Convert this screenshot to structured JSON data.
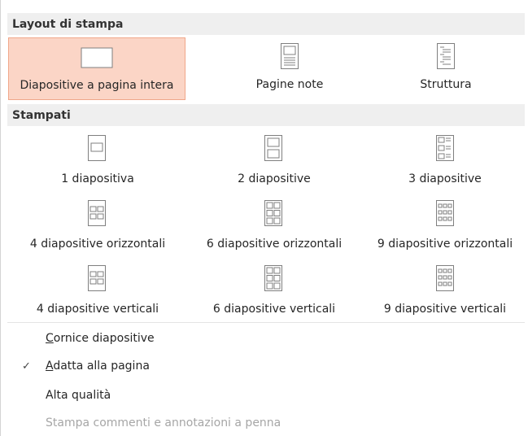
{
  "sections": {
    "layout_title": "Layout di stampa",
    "handouts_title": "Stampati"
  },
  "layout_tiles": [
    {
      "label": "Diapositive a pagina intera",
      "icon": "full-page-slide-icon",
      "selected": true
    },
    {
      "label": "Pagine note",
      "icon": "notes-page-icon",
      "selected": false
    },
    {
      "label": "Struttura",
      "icon": "outline-icon",
      "selected": false
    }
  ],
  "handouts": [
    {
      "label": "1 diapositiva",
      "icon": "one-slide-icon"
    },
    {
      "label": "2 diapositive",
      "icon": "two-slides-icon"
    },
    {
      "label": "3 diapositive",
      "icon": "three-slides-icon"
    },
    {
      "label": "4 diapositive orizzontali",
      "icon": "four-slides-horizontal-icon"
    },
    {
      "label": "6 diapositive orizzontali",
      "icon": "six-slides-horizontal-icon"
    },
    {
      "label": "9 diapositive orizzontali",
      "icon": "nine-slides-horizontal-icon"
    },
    {
      "label": "4 diapositive verticali",
      "icon": "four-slides-vertical-icon"
    },
    {
      "label": "6 diapositive verticali",
      "icon": "six-slides-vertical-icon"
    },
    {
      "label": "9 diapositive verticali",
      "icon": "nine-slides-vertical-icon"
    }
  ],
  "options": {
    "frame_first": "C",
    "frame_rest": "ornice diapositive",
    "fit_first": "A",
    "fit_rest": "datta alla pagina",
    "fit_checked": "✓",
    "quality": "Alta qualità",
    "comments": "Stampa commenti e annotazioni a penna"
  },
  "colors": {
    "header_bg": "#efefef",
    "selected_bg": "#fbd5c6",
    "selected_border": "#f0a78a",
    "icon_stroke": "#7f7f7f",
    "disabled_text": "#a6a6a6"
  }
}
